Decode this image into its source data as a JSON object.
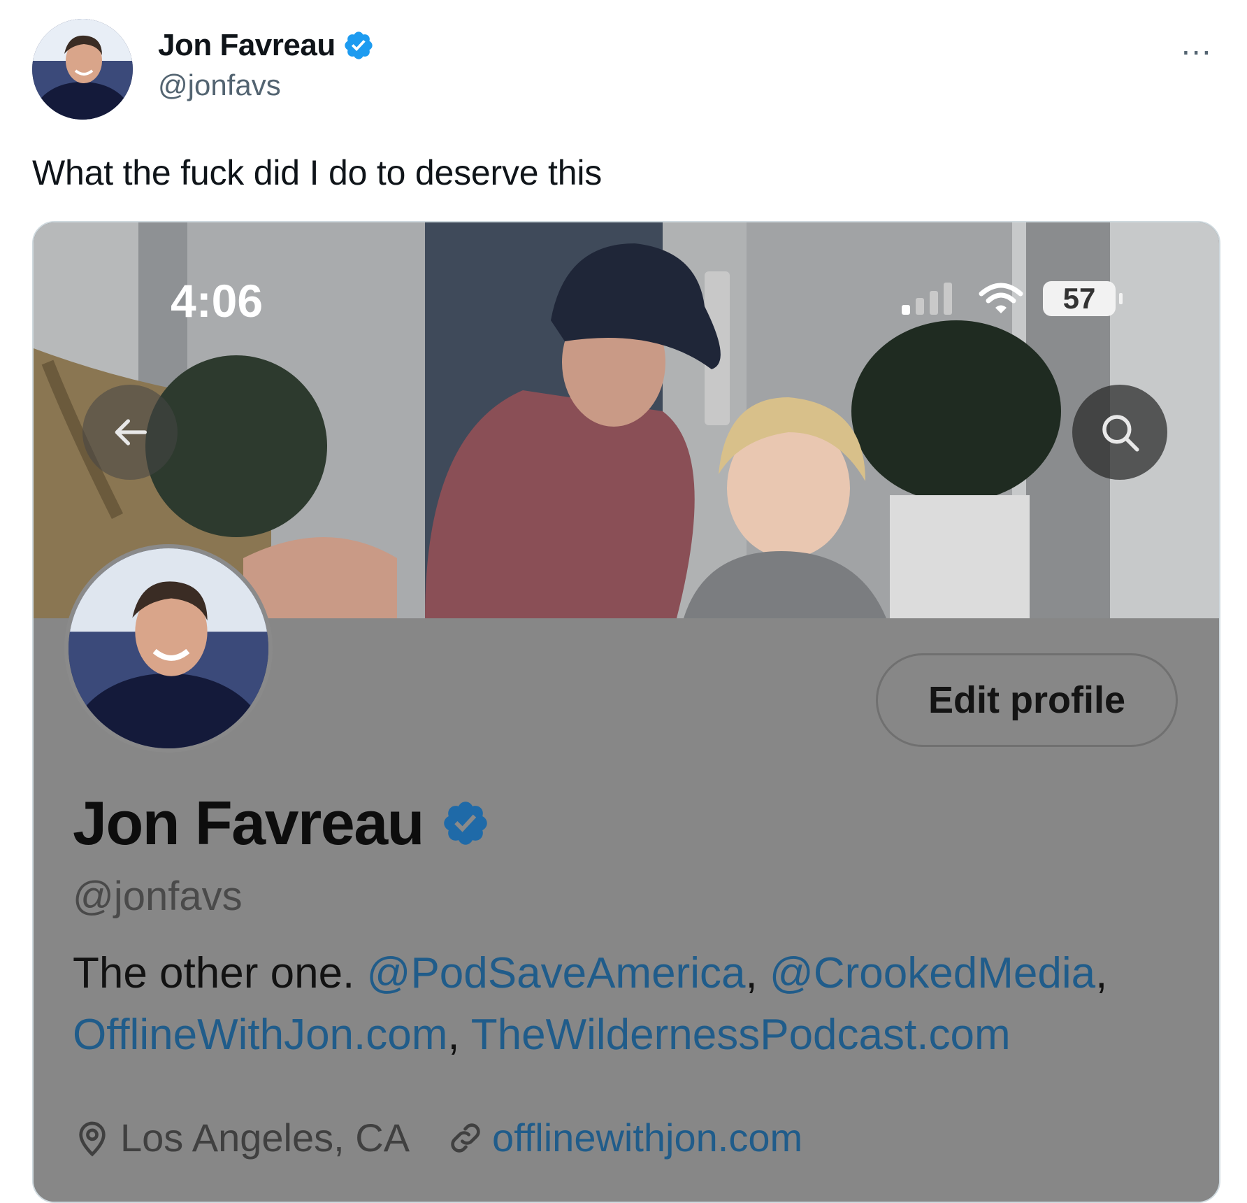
{
  "tweet": {
    "author_name": "Jon Favreau",
    "author_handle": "@jonfavs",
    "more_label": "...",
    "text": "What the fuck did I do to deserve this"
  },
  "screenshot": {
    "status_time": "4:06",
    "battery": "57",
    "profile": {
      "edit_button": "Edit profile",
      "name": "Jon Favreau",
      "handle": "@jonfavs",
      "bio_prefix": "The other one. ",
      "bio_link1": "@PodSaveAmerica",
      "bio_sep1": ", ",
      "bio_link2": "@CrookedMedia",
      "bio_sep2": ",",
      "bio_link3": "OfflineWithJon.com",
      "bio_sep3": ", ",
      "bio_link4": "TheWildernessPodcast.com",
      "location": "Los Angeles, CA",
      "website": "offlinewithjon.com"
    }
  },
  "colors": {
    "verified": "#1d9bf0",
    "link": "#205c8a",
    "overlay_gray": "#878787"
  },
  "icons": [
    "verified-badge-icon",
    "more-icon",
    "back-arrow-icon",
    "search-icon",
    "signal-icon",
    "wifi-icon",
    "location-pin-icon",
    "link-icon"
  ]
}
